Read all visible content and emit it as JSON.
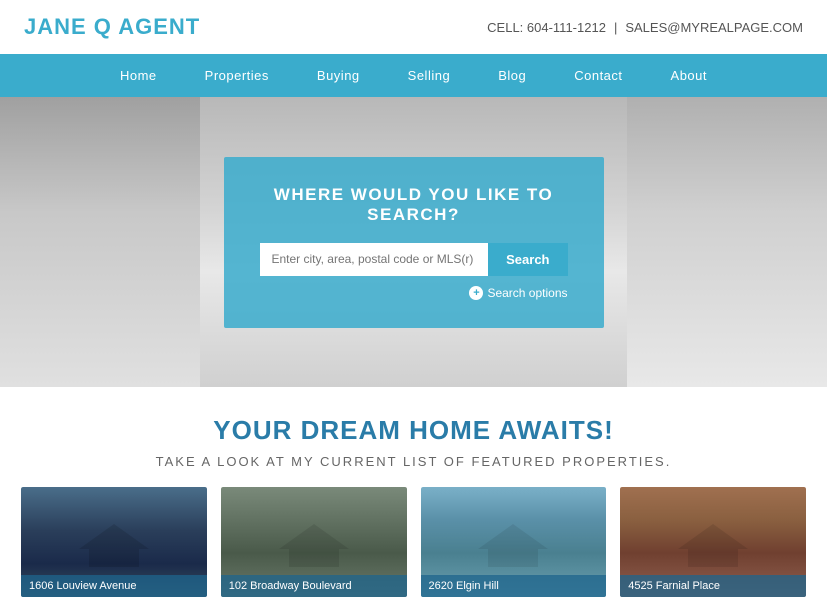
{
  "header": {
    "site_title": "JANE Q AGENT",
    "cell_label": "CELL: 604-111-1212",
    "divider": "|",
    "email_label": "SALES@MYREALPAGE.COM"
  },
  "nav": {
    "items": [
      {
        "label": "Home",
        "id": "home"
      },
      {
        "label": "Properties",
        "id": "properties"
      },
      {
        "label": "Buying",
        "id": "buying"
      },
      {
        "label": "Selling",
        "id": "selling"
      },
      {
        "label": "Blog",
        "id": "blog"
      },
      {
        "label": "Contact",
        "id": "contact"
      },
      {
        "label": "About",
        "id": "about"
      }
    ]
  },
  "hero": {
    "search_heading": "WHERE WOULD YOU LIKE TO SEARCH?",
    "search_placeholder": "Enter city, area, postal code or MLS(r) number",
    "search_button": "Search",
    "search_options": "Search options"
  },
  "dream_section": {
    "title": "YOUR DREAM HOME AWAITS!",
    "subtitle": "TAKE A LOOK AT MY CURRENT LIST OF FEATURED PROPERTIES."
  },
  "properties": [
    {
      "label": "1606 Louview Avenue",
      "id": "card-1"
    },
    {
      "label": "102 Broadway Boulevard",
      "id": "card-2"
    },
    {
      "label": "2620 Elgin Hill",
      "id": "card-3"
    },
    {
      "label": "4525 Farnial Place",
      "id": "card-4"
    }
  ]
}
